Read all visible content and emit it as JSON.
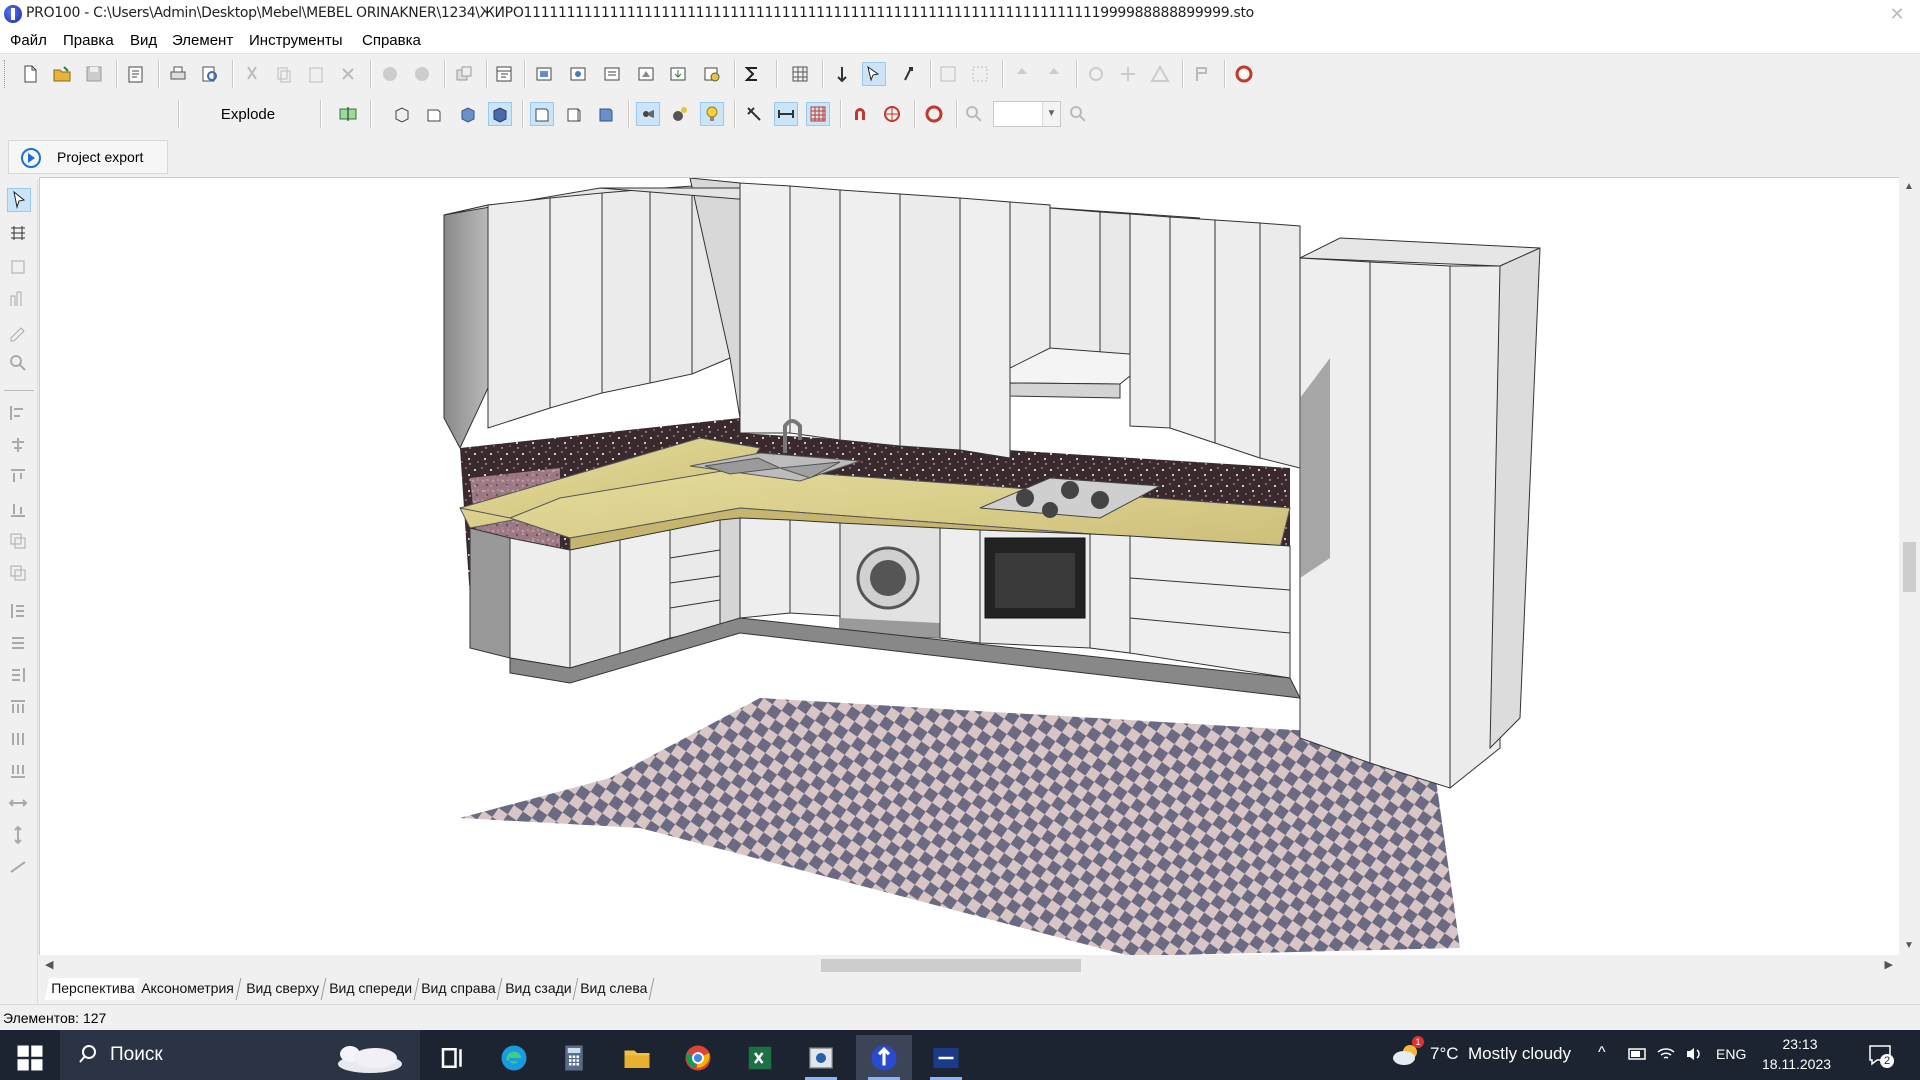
{
  "window": {
    "title": "PRO100 - C:\\Users\\Admin\\Desktop\\Mebel\\MEBEL ORINAKNER\\1234\\ЖИРО1111111111111111111111111111111111111111111111111111111111111111111999988888899999.sto"
  },
  "menu": {
    "items": [
      "Файл",
      "Правка",
      "Вид",
      "Элемент",
      "Инструменты",
      "Справка"
    ]
  },
  "toolbar": {
    "explode_label": "Explode",
    "zoom_value": ""
  },
  "project_export": {
    "label": "Project export"
  },
  "view_tabs": [
    "Перспектива",
    "Аксонометрия",
    "Вид сверху",
    "Вид спереди",
    "Вид справа",
    "Вид сзади",
    "Вид слева"
  ],
  "status": {
    "elements_count": "Элементов: 127"
  },
  "taskbar": {
    "search_label": "Поиск",
    "weather": {
      "temperature": "7°C",
      "description": "Mostly cloudy",
      "alert_badge": "1"
    },
    "language": "ENG",
    "time": "23:13",
    "date": "18.11.2023",
    "notifications_count": "2"
  },
  "colors": {
    "titlebar_bg": "#ffffff",
    "taskbar_bg": "#1c2431",
    "accent": "#1b6fd6",
    "toolbar_active": "#cce4f7"
  }
}
